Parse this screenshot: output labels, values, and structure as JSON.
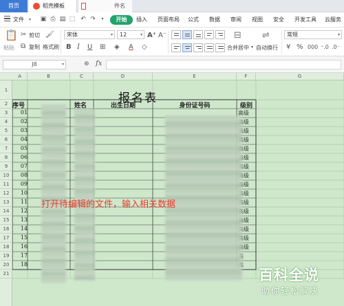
{
  "tabs": {
    "home": "首页",
    "template": "稻壳模板",
    "file_title": "件名"
  },
  "menu": {
    "file": "文件",
    "start": "开始",
    "items": [
      "插入",
      "页面布局",
      "公式",
      "数据",
      "审阅",
      "视图",
      "安全",
      "开发工具",
      "云服务"
    ]
  },
  "ribbon": {
    "paste": "粘贴",
    "cut": "剪切",
    "copy": "复制",
    "format_painter": "格式刷",
    "font_name": "宋体",
    "font_size": "12",
    "merge_center": "合并居中",
    "wrap_text": "自动换行",
    "number_format": "常规",
    "icons": {
      "bold": "B",
      "italic": "I",
      "underline": "U",
      "font_color": "A",
      "currency": "¥",
      "percent": "%"
    }
  },
  "formula_bar": {
    "name_box": "J8",
    "fx": "fx"
  },
  "sheet": {
    "columns": [
      "A",
      "B",
      "C",
      "D",
      "E",
      "F",
      "G"
    ],
    "rows": [
      "1",
      "2",
      "3",
      "4",
      "5",
      "6",
      "7",
      "8",
      "9",
      "10",
      "11",
      "12",
      "13",
      "14",
      "15",
      "16",
      "17",
      "18",
      "19",
      "20",
      "21"
    ],
    "title": "报名表",
    "headers": {
      "seq": "序号",
      "name": "姓名",
      "birth": "出生日期",
      "id": "身份证号码",
      "level": "级别"
    },
    "seq_values": [
      "01",
      "02",
      "03",
      "04",
      "05",
      "06",
      "07",
      "08",
      "09",
      "10",
      "11",
      "12",
      "13",
      "14",
      "15",
      "16",
      "17",
      "18"
    ],
    "level_values": [
      "高级",
      "高级",
      "高级",
      "高级",
      "高级",
      "高级",
      "高级",
      "高级",
      "高级",
      "高级",
      "高级",
      "高级",
      "高级",
      "高级",
      "高级",
      "高级",
      "高",
      "高"
    ]
  },
  "annotation": "打开待编辑的文件，输入相关数据",
  "watermark": {
    "title": "百科全说",
    "subtitle": "助你轻松解决"
  }
}
